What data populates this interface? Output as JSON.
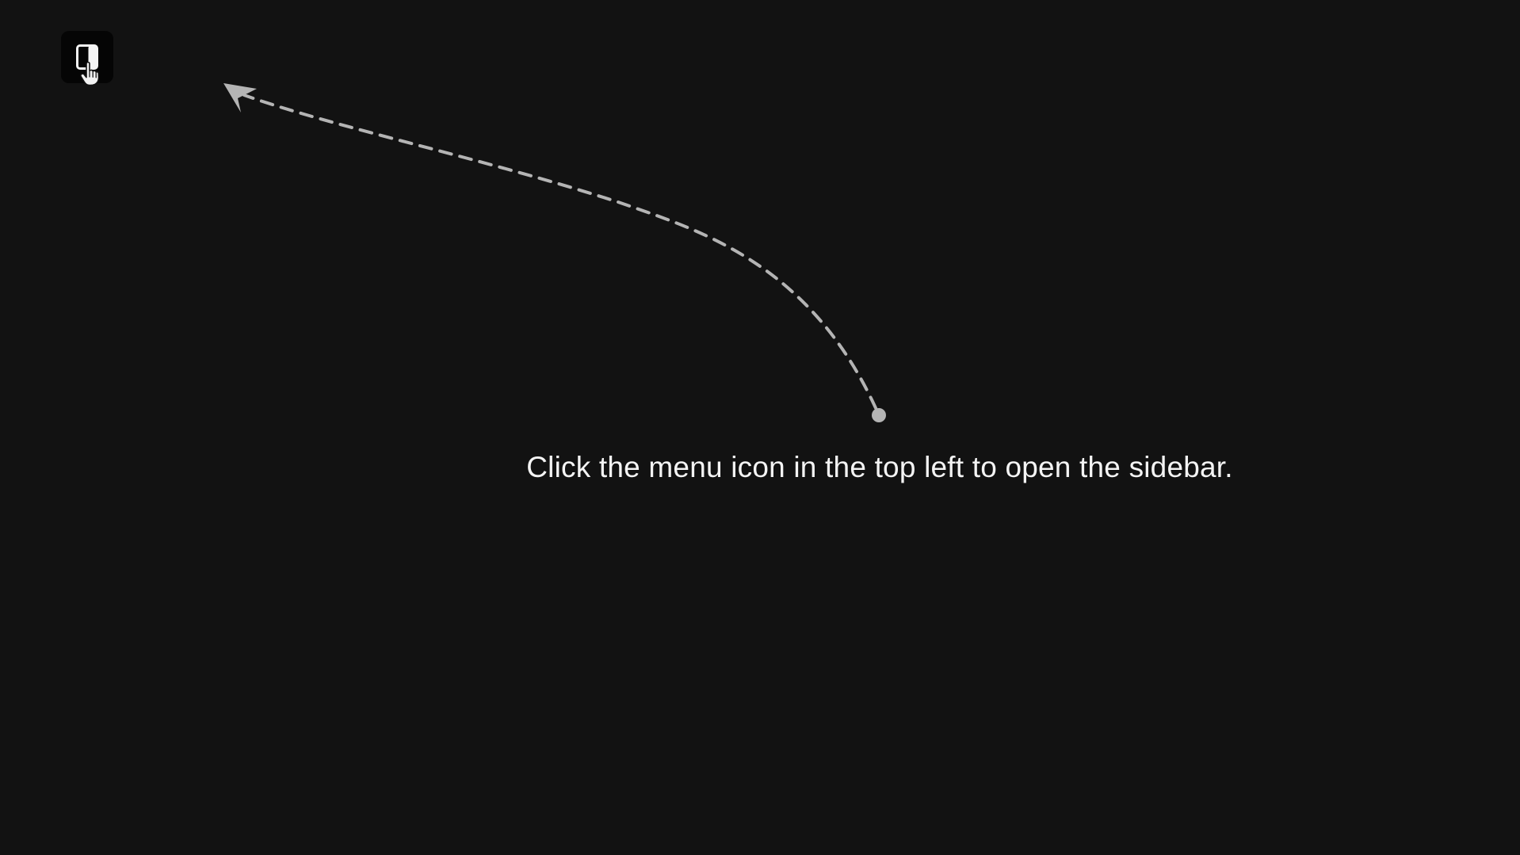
{
  "hint": {
    "message": "Click the menu icon in the top left to open the sidebar."
  },
  "icons": {
    "sidebar_toggle": "sidebar-panel-icon",
    "cursor": "hand-pointer-icon",
    "arrow": "dashed-curved-arrow"
  },
  "colors": {
    "background": "#121212",
    "button_background": "#050505",
    "text": "#f4f4f4",
    "arrow": "#b4b4b4"
  }
}
